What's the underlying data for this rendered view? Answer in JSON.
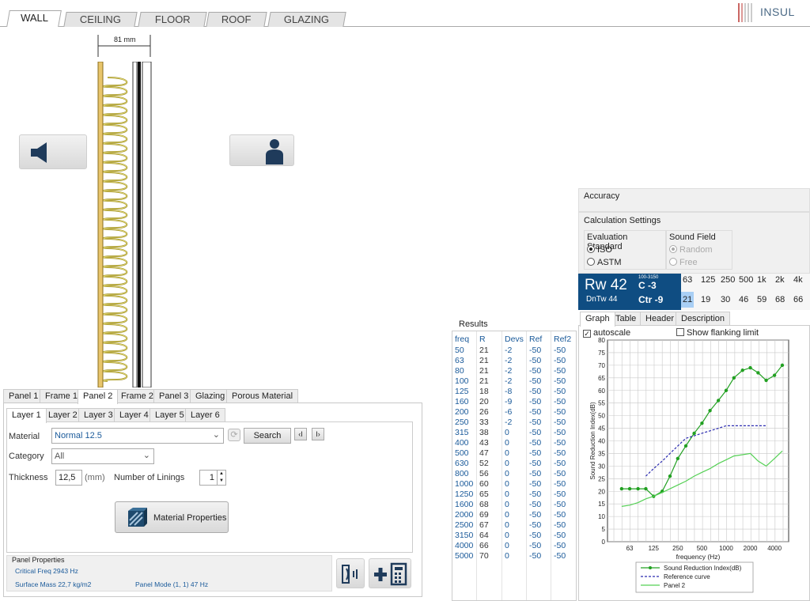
{
  "top_tabs": [
    "WALL",
    "CEILING",
    "FLOOR",
    "ROOF",
    "GLAZING"
  ],
  "logo": {
    "text": "INSUL"
  },
  "dimension": "81 mm",
  "buttons": {
    "source_icon": "speaker-icon",
    "receiver_icon": "listener-icon"
  },
  "panel_tabs": [
    "Panel 1",
    "Frame 1",
    "Panel 2",
    "Frame 2",
    "Panel 3",
    "Glazing",
    "Porous Material"
  ],
  "layer_tabs": [
    "Layer 1",
    "Layer 2",
    "Layer 3",
    "Layer 4",
    "Layer 5",
    "Layer 6"
  ],
  "material": {
    "label": "Material",
    "value": "Normal 12.5",
    "search": "Search",
    "prev": "‹I",
    "next": "I›"
  },
  "category": {
    "label": "Category",
    "value": "All"
  },
  "thickness": {
    "label": "Thickness",
    "value": "12,5",
    "unit": "(mm)"
  },
  "linings": {
    "label": "Number of Linings",
    "value": "1"
  },
  "material_properties": "Material Properties",
  "panel_properties": {
    "title": "Panel Properties",
    "critical_freq": "Critical Freq 2943 Hz",
    "surface_mass": "Surface Mass 22,7 kg/m2",
    "panel_mode": "Panel Mode (1, 1) 47 Hz"
  },
  "results": {
    "title": "Results",
    "headers": [
      "freq",
      "R",
      "Devs",
      "Ref",
      "Ref2"
    ],
    "rows": [
      [
        "50",
        "21",
        "-2",
        "-50",
        "-50"
      ],
      [
        "63",
        "21",
        "-2",
        "-50",
        "-50"
      ],
      [
        "80",
        "21",
        "-2",
        "-50",
        "-50"
      ],
      [
        "100",
        "21",
        "-2",
        "-50",
        "-50"
      ],
      [
        "125",
        "18",
        "-8",
        "-50",
        "-50"
      ],
      [
        "160",
        "20",
        "-9",
        "-50",
        "-50"
      ],
      [
        "200",
        "26",
        "-6",
        "-50",
        "-50"
      ],
      [
        "250",
        "33",
        "-2",
        "-50",
        "-50"
      ],
      [
        "315",
        "38",
        "0",
        "-50",
        "-50"
      ],
      [
        "400",
        "43",
        "0",
        "-50",
        "-50"
      ],
      [
        "500",
        "47",
        "0",
        "-50",
        "-50"
      ],
      [
        "630",
        "52",
        "0",
        "-50",
        "-50"
      ],
      [
        "800",
        "56",
        "0",
        "-50",
        "-50"
      ],
      [
        "1000",
        "60",
        "0",
        "-50",
        "-50"
      ],
      [
        "1250",
        "65",
        "0",
        "-50",
        "-50"
      ],
      [
        "1600",
        "68",
        "0",
        "-50",
        "-50"
      ],
      [
        "2000",
        "69",
        "0",
        "-50",
        "-50"
      ],
      [
        "2500",
        "67",
        "0",
        "-50",
        "-50"
      ],
      [
        "3150",
        "64",
        "0",
        "-50",
        "-50"
      ],
      [
        "4000",
        "66",
        "0",
        "-50",
        "-50"
      ],
      [
        "5000",
        "70",
        "0",
        "-50",
        "-50"
      ]
    ]
  },
  "accuracy": "Accuracy",
  "calc_settings": "Calculation Settings",
  "eval_standard": {
    "title": "Evaluation Standard",
    "options": [
      "ISO",
      "ASTM"
    ],
    "selected": "ISO"
  },
  "sound_field": {
    "title": "Sound Field",
    "options": [
      "Random",
      "Free"
    ],
    "selected": "Random"
  },
  "rating": {
    "rw": "Rw 42",
    "c_range": "100-3150",
    "c": "C -3",
    "dntw": "DnTw 44",
    "ctr": "Ctr -9"
  },
  "octave": {
    "bands": [
      "63",
      "125",
      "250",
      "500",
      "1k",
      "2k",
      "4k"
    ],
    "values": [
      "21",
      "19",
      "30",
      "46",
      "59",
      "68",
      "66"
    ]
  },
  "graph_tabs": [
    "Graph",
    "Table",
    "Header",
    "Description"
  ],
  "autoscale": "autoscale",
  "flanking": "Show flanking limit",
  "chart_data": {
    "type": "line",
    "xlabel": "frequency (Hz)",
    "ylabel": "Sound Reduction Index(dB)",
    "x_ticks": [
      "63",
      "125",
      "250",
      "500",
      "1000",
      "2000",
      "4000"
    ],
    "ylim": [
      0,
      80
    ],
    "y_ticks": [
      0,
      5,
      10,
      15,
      20,
      25,
      30,
      35,
      40,
      45,
      50,
      55,
      60,
      65,
      70,
      75,
      80
    ],
    "grid": true,
    "legend_position": "bottom",
    "x": [
      50,
      63,
      80,
      100,
      125,
      160,
      200,
      250,
      315,
      400,
      500,
      630,
      800,
      1000,
      1250,
      1600,
      2000,
      2500,
      3150,
      4000,
      5000
    ],
    "series": [
      {
        "name": "Sound Reduction Index(dB)",
        "color": "#22a022",
        "style": "solid-markers",
        "values": [
          21,
          21,
          21,
          21,
          18,
          20,
          26,
          33,
          38,
          43,
          47,
          52,
          56,
          60,
          65,
          68,
          69,
          67,
          64,
          66,
          70
        ]
      },
      {
        "name": "Reference curve",
        "color": "#2b2bb0",
        "style": "dashed",
        "x": [
          100,
          125,
          160,
          200,
          250,
          315,
          400,
          500,
          630,
          800,
          1000,
          1250,
          1600,
          2000,
          2500,
          3150
        ],
        "values": [
          26,
          29,
          32,
          35,
          38,
          41,
          42,
          43,
          44,
          45,
          46,
          46,
          46,
          46,
          46,
          46
        ]
      },
      {
        "name": "Panel 2",
        "color": "#55d055",
        "style": "solid",
        "values": [
          14,
          14.5,
          15.5,
          17,
          18,
          19.5,
          21,
          22.5,
          24,
          26,
          27.5,
          29,
          31,
          32.5,
          34,
          34.5,
          35,
          32,
          30,
          33,
          36
        ]
      }
    ]
  }
}
